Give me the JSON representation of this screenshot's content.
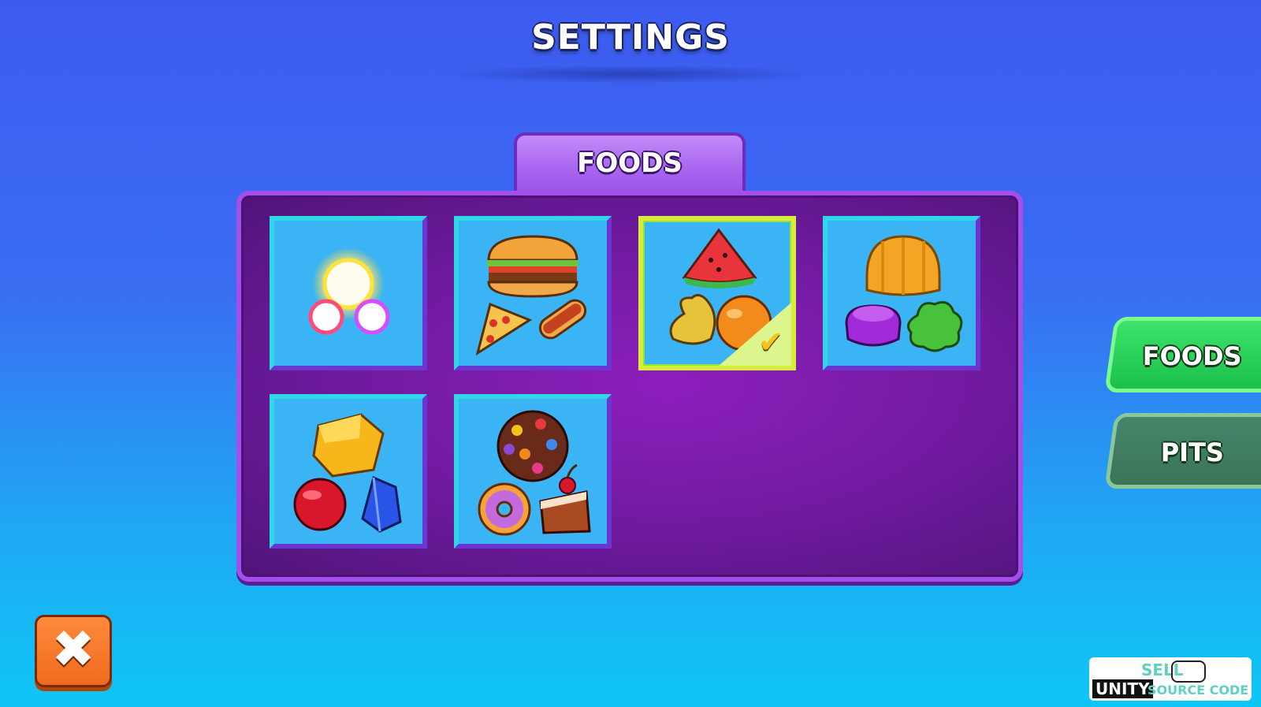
{
  "header": {
    "title": "SETTINGS"
  },
  "panel": {
    "tab_label": "FOODS"
  },
  "food_sets": [
    {
      "id": "glow-orbs",
      "selected": false
    },
    {
      "id": "fast-food",
      "selected": false
    },
    {
      "id": "fruits",
      "selected": true
    },
    {
      "id": "jelly",
      "selected": false
    },
    {
      "id": "gems",
      "selected": false
    },
    {
      "id": "desserts",
      "selected": false
    }
  ],
  "side_menu": {
    "foods_label": "FOODS",
    "pits_label": "PITS"
  },
  "close_button": {
    "glyph": "✖"
  },
  "watermark": {
    "line1": "SELL",
    "line2a": "UNITY",
    "line2b": "SOURCE CODE"
  },
  "colors": {
    "accent_selected": "#d8ec3c",
    "tab_active": "#1fc04a",
    "close": "#f06a1e"
  }
}
